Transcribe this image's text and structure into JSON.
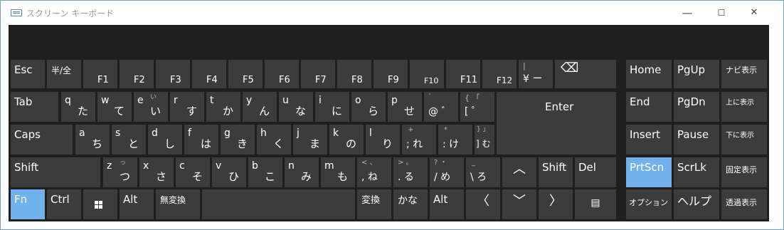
{
  "window": {
    "title": "スクリーン キーボード",
    "controls": {
      "minimize": "—",
      "maximize": "☐",
      "close": "✕"
    }
  },
  "keys": {
    "esc": "Esc",
    "hankaku": "半/全",
    "f1": "F1",
    "f2": "F2",
    "f3": "F3",
    "f4": "F4",
    "f5": "F5",
    "f6": "F6",
    "f7": "F7",
    "f8": "F8",
    "f9": "F9",
    "f10": "F10",
    "f11": "F11",
    "f12": "F12",
    "yen_top": "|",
    "yen_bottom": "¥ ー",
    "backspace": "⌫",
    "home": "Home",
    "pgup": "PgUp",
    "navi": "ナビ表示",
    "tab": "Tab",
    "q": {
      "en": "q",
      "kana": "た"
    },
    "w": {
      "en": "w",
      "kana": "て"
    },
    "e": {
      "en": "e",
      "hint": "い",
      "kana": "い"
    },
    "r": {
      "en": "r",
      "kana": "す"
    },
    "t": {
      "en": "t",
      "kana": "か"
    },
    "y": {
      "en": "y",
      "kana": "ん"
    },
    "u": {
      "en": "u",
      "kana": "な"
    },
    "i": {
      "en": "i",
      "kana": "に"
    },
    "o": {
      "en": "o",
      "kana": "ら"
    },
    "p": {
      "en": "p",
      "kana": "せ"
    },
    "at": {
      "top": "`",
      "bottom": "@ ゛"
    },
    "bracket": {
      "top": "{ 「",
      "bottom": "[ ゜"
    },
    "enter": "Enter",
    "end": "End",
    "pgdn": "PgDn",
    "move_up": "上に表示",
    "caps": "Caps",
    "a": {
      "en": "a",
      "kana": "ち"
    },
    "s": {
      "en": "s",
      "kana": "と"
    },
    "d": {
      "en": "d",
      "kana": "し"
    },
    "f": {
      "en": "f",
      "kana": "は"
    },
    "g": {
      "en": "g",
      "kana": "き"
    },
    "h": {
      "en": "h",
      "kana": "く"
    },
    "j": {
      "en": "j",
      "kana": "ま"
    },
    "k": {
      "en": "k",
      "kana": "の"
    },
    "l": {
      "en": "l",
      "kana": "り"
    },
    "semicolon": {
      "top": "+",
      "bottom": "; れ"
    },
    "colon": {
      "top": "*",
      "bottom": ": け"
    },
    "rbracket": {
      "top": "} 」",
      "bottom": "] む"
    },
    "insert": "Insert",
    "pause": "Pause",
    "move_down": "下に表示",
    "shift_left": "Shift",
    "z": {
      "en": "z",
      "hint": "っ",
      "kana": "つ"
    },
    "x": {
      "en": "x",
      "kana": "さ"
    },
    "c": {
      "en": "c",
      "kana": "そ"
    },
    "v": {
      "en": "v",
      "kana": "ひ"
    },
    "b": {
      "en": "b",
      "kana": "こ"
    },
    "n": {
      "en": "n",
      "kana": "み"
    },
    "m": {
      "en": "m",
      "kana": "も"
    },
    "comma": {
      "top": "< 、",
      "bottom": ", ね"
    },
    "period": {
      "top": "> 。",
      "bottom": ". る"
    },
    "slash": {
      "top": "? ・",
      "bottom": "/ め"
    },
    "backslash": {
      "top": "_",
      "bottom": "\\ ろ"
    },
    "up": "︿",
    "shift_right": "Shift",
    "del": "Del",
    "prtscn": "PrtScn",
    "scrlk": "ScrLk",
    "dock": "固定表示",
    "fn": "Fn",
    "ctrl": "Ctrl",
    "alt_left": "Alt",
    "muhenkan": "無変換",
    "henkan": "変換",
    "kana_key": "かな",
    "alt_right": "Alt",
    "left": "〈",
    "down": "﹀",
    "right": "〉",
    "menu": "▤",
    "options": "オプション",
    "help": "ヘルプ",
    "fade": "透過表示"
  },
  "colors": {
    "keyboard_bg": "#1f1f1f",
    "key_bg": "#3c3c3c",
    "key_text": "#ffffff",
    "highlight": "#72b2ec"
  }
}
